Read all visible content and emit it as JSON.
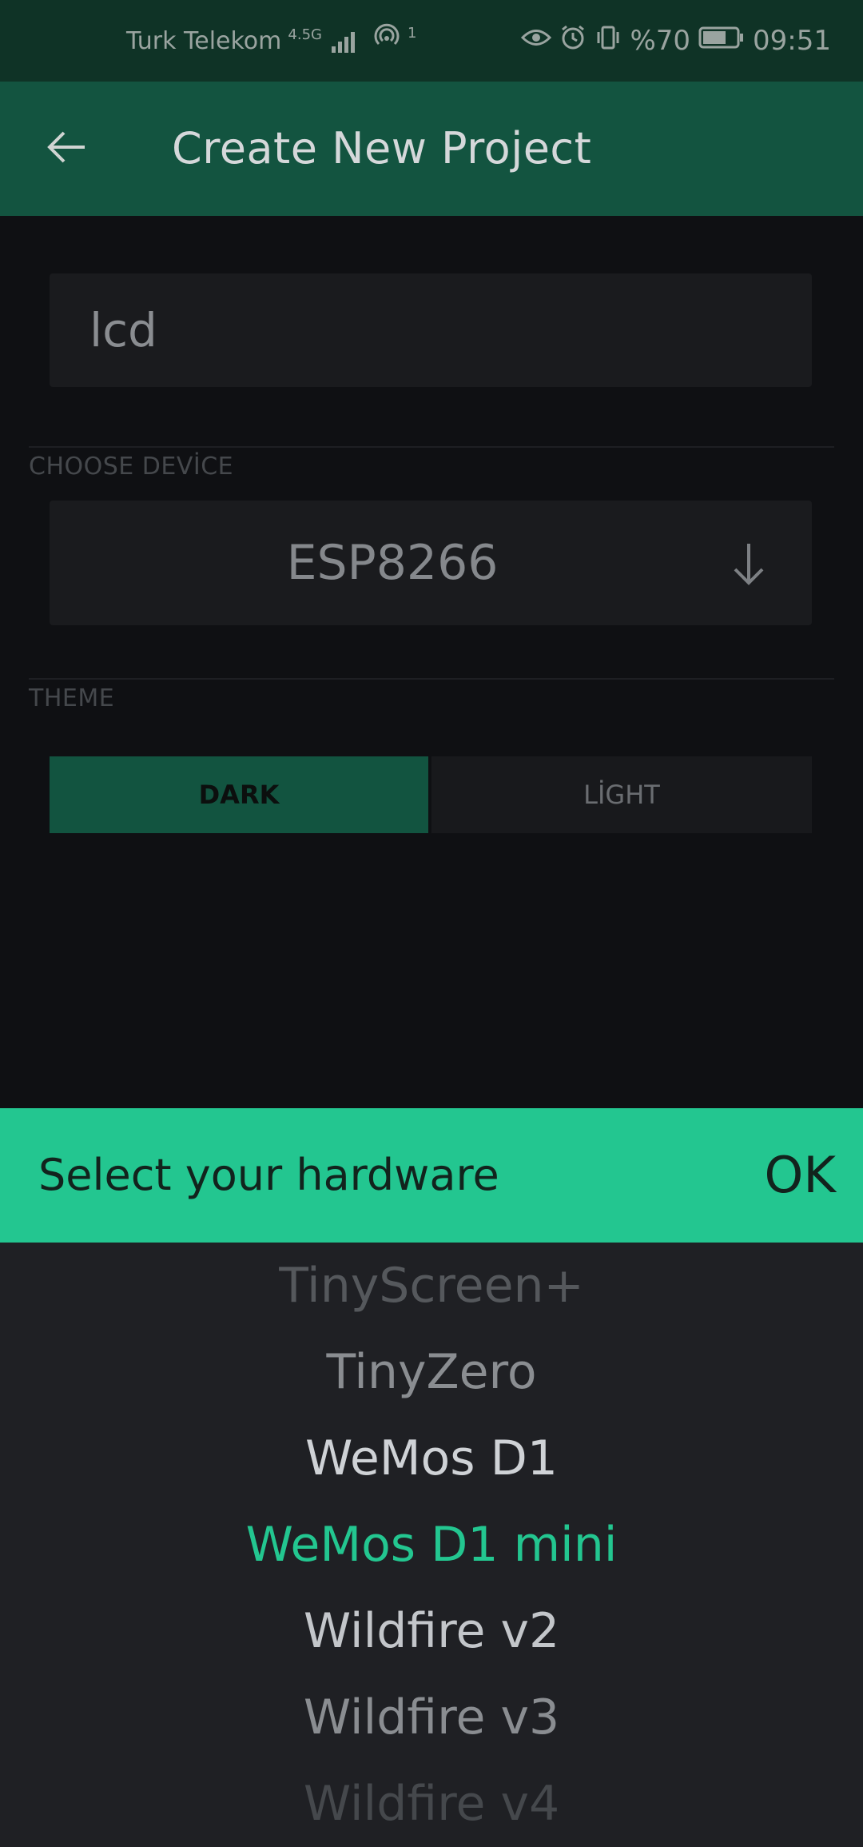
{
  "status_bar": {
    "carrier": "Turk Telekom",
    "network_type": "4.5G",
    "hotspot_count": "1",
    "battery": "%70",
    "time": "09:51",
    "icons": [
      "signal-icon",
      "hotspot-icon",
      "eye-icon",
      "alarm-icon",
      "vibrate-icon",
      "battery-icon"
    ],
    "battery_level": 0.7
  },
  "app_bar": {
    "back_icon": "arrow-left-icon",
    "title": "Create New Project"
  },
  "form": {
    "project_name": "lcd",
    "choose_device_label": "CHOOSE DEVİCE",
    "device_value": "ESP8266",
    "device_icon": "arrow-down-icon",
    "theme_label": "THEME",
    "theme_dark": "DARK",
    "theme_light": "LİGHT",
    "selected_theme": "DARK"
  },
  "picker": {
    "title": "Select your hardware",
    "ok_label": "OK",
    "items": [
      "TinyScreen+",
      "TinyZero",
      "WeMos D1",
      "WeMos D1 mini",
      "Wildfire v2",
      "Wildfire v3",
      "Wildfire v4"
    ],
    "selected": "WeMos D1 mini"
  },
  "colors": {
    "accent": "#23c690",
    "app_bar": "#135440",
    "status_bar": "#0f3326",
    "background": "#0f1013",
    "picker_bg": "#1f2024"
  }
}
